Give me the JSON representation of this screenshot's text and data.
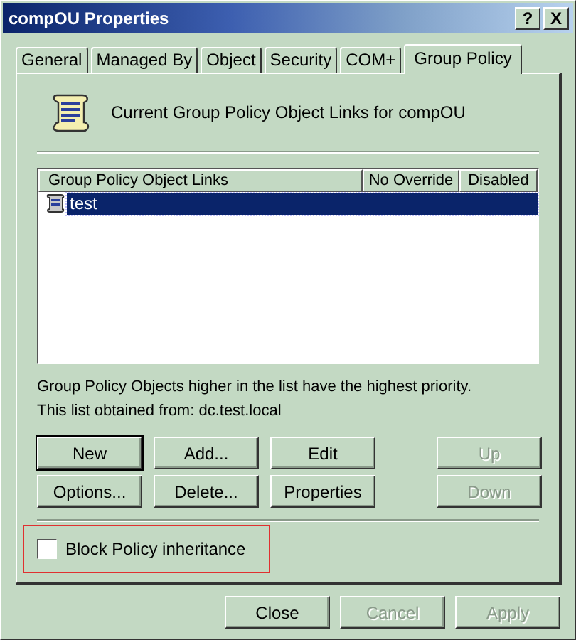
{
  "window": {
    "title": "compOU Properties",
    "title_buttons": [
      "?",
      "X"
    ]
  },
  "tabs": [
    {
      "label": "General",
      "selected": false
    },
    {
      "label": "Managed By",
      "selected": false
    },
    {
      "label": "Object",
      "selected": false
    },
    {
      "label": "Security",
      "selected": false
    },
    {
      "label": "COM+",
      "selected": false
    },
    {
      "label": "Group Policy",
      "selected": true
    }
  ],
  "heading": "Current Group Policy Object Links for compOU",
  "links_list": {
    "columns": [
      "Group Policy Object Links",
      "No Override",
      "Disabled"
    ],
    "rows": [
      {
        "name": "test",
        "selected": true
      }
    ]
  },
  "info_lines": [
    "Group Policy Objects higher in the list have the highest priority.",
    "This list obtained from: dc.test.local"
  ],
  "buttons": [
    {
      "label": "New",
      "default": true,
      "disabled": false
    },
    {
      "label": "Add...",
      "default": false,
      "disabled": false
    },
    {
      "label": "Edit",
      "default": false,
      "disabled": false
    },
    {
      "label": "Up",
      "default": false,
      "disabled": true
    },
    {
      "label": "Options...",
      "default": false,
      "disabled": false
    },
    {
      "label": "Delete...",
      "default": false,
      "disabled": false
    },
    {
      "label": "Properties",
      "default": false,
      "disabled": false
    },
    {
      "label": "Down",
      "default": false,
      "disabled": true
    }
  ],
  "checkbox": {
    "label": "Block Policy inheritance",
    "checked": false,
    "highlighted": true
  },
  "footer_buttons": [
    {
      "label": "Close",
      "disabled": false
    },
    {
      "label": "Cancel",
      "disabled": true
    },
    {
      "label": "Apply",
      "disabled": true
    }
  ]
}
